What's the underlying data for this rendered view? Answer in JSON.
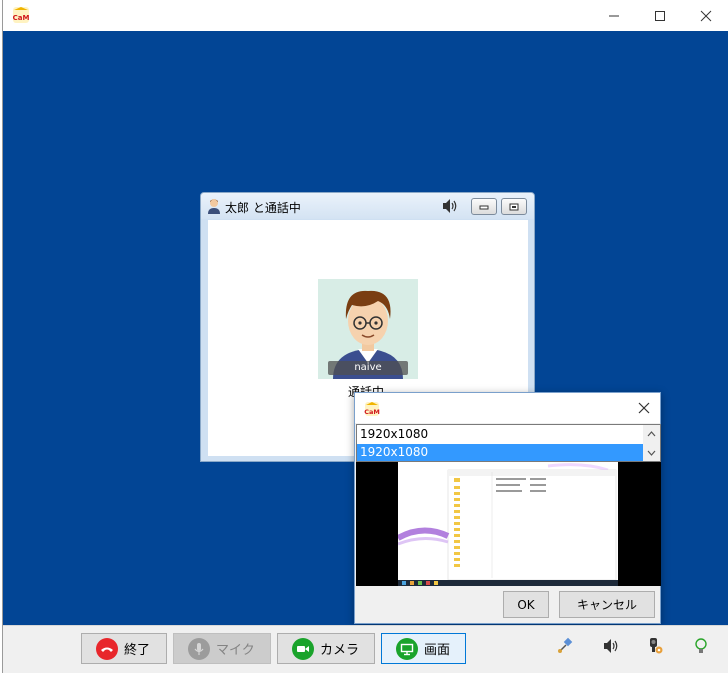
{
  "app": {
    "logo_text": "CaM"
  },
  "call_window": {
    "title": "太郎 と通話中",
    "avatar_name": "naive",
    "status": "通話中"
  },
  "dialog": {
    "logo_text": "CaM",
    "options": [
      "1920x1080",
      "1920x1080"
    ],
    "selected_index": 1,
    "ok_label": "OK",
    "cancel_label": "キャンセル"
  },
  "toolbar": {
    "end_label": "終了",
    "mic_label": "マイク",
    "camera_label": "カメラ",
    "screen_label": "画面"
  },
  "colors": {
    "desktop_bg": "#024595",
    "selection": "#3399ff",
    "end_icon": "#e8262b",
    "camera_icon": "#1aa32b",
    "screen_icon": "#1aa32b"
  },
  "icons": {
    "tray": [
      "satellite-icon",
      "speaker-icon",
      "webcam-settings-icon",
      "lightbulb-icon"
    ]
  }
}
